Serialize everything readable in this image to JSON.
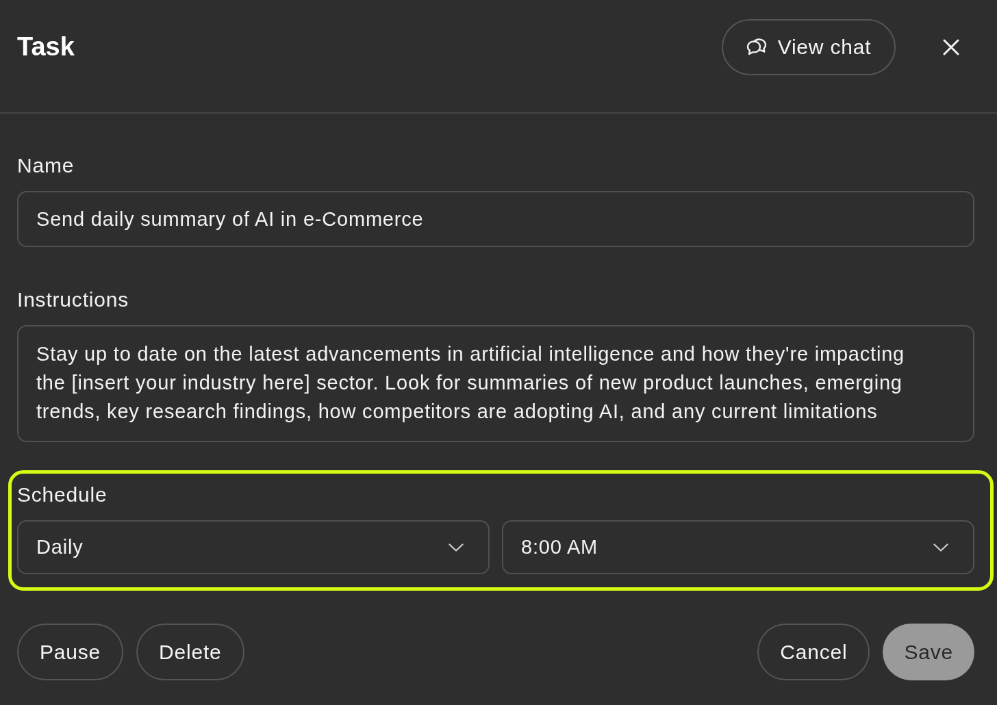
{
  "header": {
    "title": "Task",
    "view_chat": "View chat"
  },
  "fields": [
    {
      "kind": "text",
      "label": "Name",
      "value": "Send daily summary of AI in e-Commerce"
    },
    {
      "kind": "textarea",
      "label": "Instructions",
      "value": "Stay up to date on the latest advancements in artificial intelligence and how they're impacting the [insert your industry here] sector. Look for summaries of new product launches, emerging trends, key research findings, how competitors are adopting AI, and any current limitations"
    }
  ],
  "schedule": {
    "label": "Schedule",
    "highlighted": true,
    "selects": [
      {
        "value": "Daily"
      },
      {
        "value": "8:00 AM"
      }
    ]
  },
  "footer": {
    "left": [
      {
        "label": "Pause",
        "kind": "outline",
        "disabled": false
      },
      {
        "label": "Delete",
        "kind": "outline",
        "disabled": false
      }
    ],
    "right": [
      {
        "label": "Cancel",
        "kind": "outline",
        "disabled": false
      },
      {
        "label": "Save",
        "kind": "filled",
        "disabled": true
      }
    ]
  }
}
